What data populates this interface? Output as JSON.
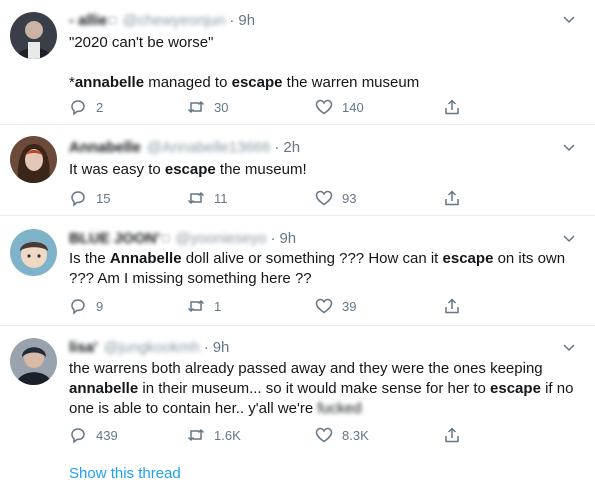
{
  "tweets": [
    {
      "display_name": "- allie ",
      "handle": "@chewyeonjun",
      "time": "9h",
      "lines": [
        "\"2020 can't be worse\"",
        "",
        "*annabelle managed to escape the warren museum"
      ],
      "text_parts": [
        {
          "t": "\"2020 can't be worse\""
        },
        {
          "t": "*",
          "p": 2
        },
        {
          "t": "annabelle",
          "b": true,
          "p": 2
        },
        {
          "t": " managed to ",
          "p": 2
        },
        {
          "t": "escape",
          "b": true,
          "p": 2
        },
        {
          "t": " the warren museum",
          "p": 2
        }
      ],
      "replies": "2",
      "retweets": "30",
      "likes": "140"
    },
    {
      "display_name": "Annabelle",
      "handle": "@Annabelle13666",
      "time": "2h",
      "replies": "15",
      "retweets": "11",
      "likes": "93"
    },
    {
      "display_name": "BLUE JOON'",
      "handle": "@yoonieseyo",
      "time": "9h",
      "replies": "9",
      "retweets": "1",
      "likes": "39"
    },
    {
      "display_name": "lisa'",
      "handle": "@jungkookmh",
      "time": "9h",
      "replies": "439",
      "retweets": "1.6K",
      "likes": "8.3K"
    }
  ],
  "text": {
    "t1_a": "\"2020 can't be worse\"",
    "t1_b1": "*",
    "t1_b2": "annabelle",
    "t1_b3": " managed to ",
    "t1_b4": "escape",
    "t1_b5": " the warren museum",
    "t2_a": "It was easy to ",
    "t2_b": "escape",
    "t2_c": " the museum!",
    "t3_a": "Is the ",
    "t3_b": "Annabelle",
    "t3_c": " doll alive or something ??? How can it ",
    "t3_d": "escape",
    "t3_e": " on its own ??? Am I missing something here ??",
    "t4_a": "the warrens both already passed away and they were the ones keeping ",
    "t4_b": "annabelle",
    "t4_c": " in their museum... so it would make sense for her to ",
    "t4_d": "escape",
    "t4_e": " if no one is able to contain her.. y'all we're ",
    "t4_f": "fucked"
  },
  "show_thread": "Show this thread",
  "separator": "·",
  "colors": {
    "link": "#1da1f2",
    "meta": "#657786",
    "border": "#e6ecf0"
  },
  "icons": [
    "reply-icon",
    "retweet-icon",
    "like-icon",
    "share-icon",
    "chevron-down-icon"
  ]
}
